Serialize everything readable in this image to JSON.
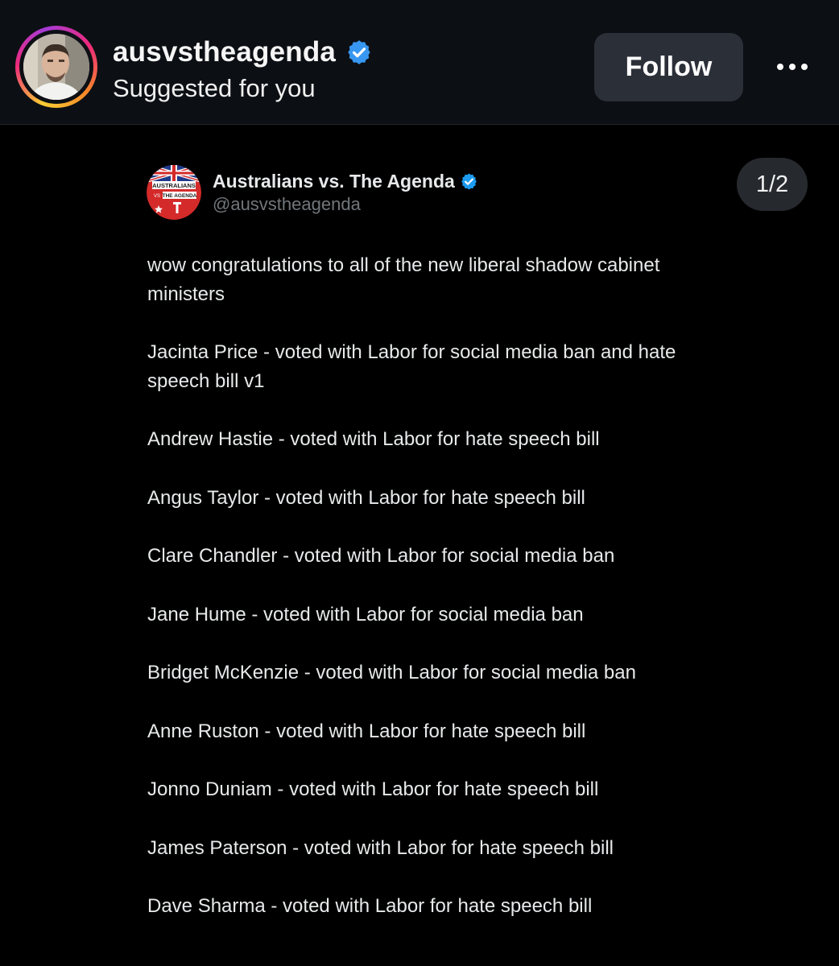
{
  "post_header": {
    "username": "ausvstheagenda",
    "subtitle": "Suggested for you",
    "follow_label": "Follow",
    "verified_icon": "verified-badge-icon",
    "more_icon": "more-horizontal-icon",
    "story_ring_colors": [
      "#f9ce34",
      "#ee2a7b",
      "#a53bd8",
      "#f58529"
    ]
  },
  "tweet": {
    "display_name": "Australians vs. The Agenda",
    "handle": "@ausvstheagenda",
    "page_counter": "1/2",
    "logo_text_top": "AUSTRALIANS",
    "logo_text_mid": "VS",
    "logo_text_bottom": "THE AGENDA",
    "verified_color": "#1d9bf0",
    "paragraphs": [
      "wow congratulations to all of the new liberal shadow cabinet ministers",
      "Jacinta Price - voted with Labor for social media ban and hate speech bill v1",
      "Andrew Hastie - voted with Labor for hate speech bill",
      "Angus Taylor - voted with Labor for hate speech bill",
      "Clare Chandler - voted with Labor for social media ban",
      "Jane Hume - voted with Labor for social media ban",
      "Bridget McKenzie - voted with Labor for social media ban",
      "Anne Ruston - voted with Labor for hate speech bill",
      "Jonno Duniam - voted with Labor for hate speech bill",
      "James Paterson - voted with Labor for hate speech bill",
      "Dave Sharma - voted with Labor for hate speech bill"
    ]
  }
}
